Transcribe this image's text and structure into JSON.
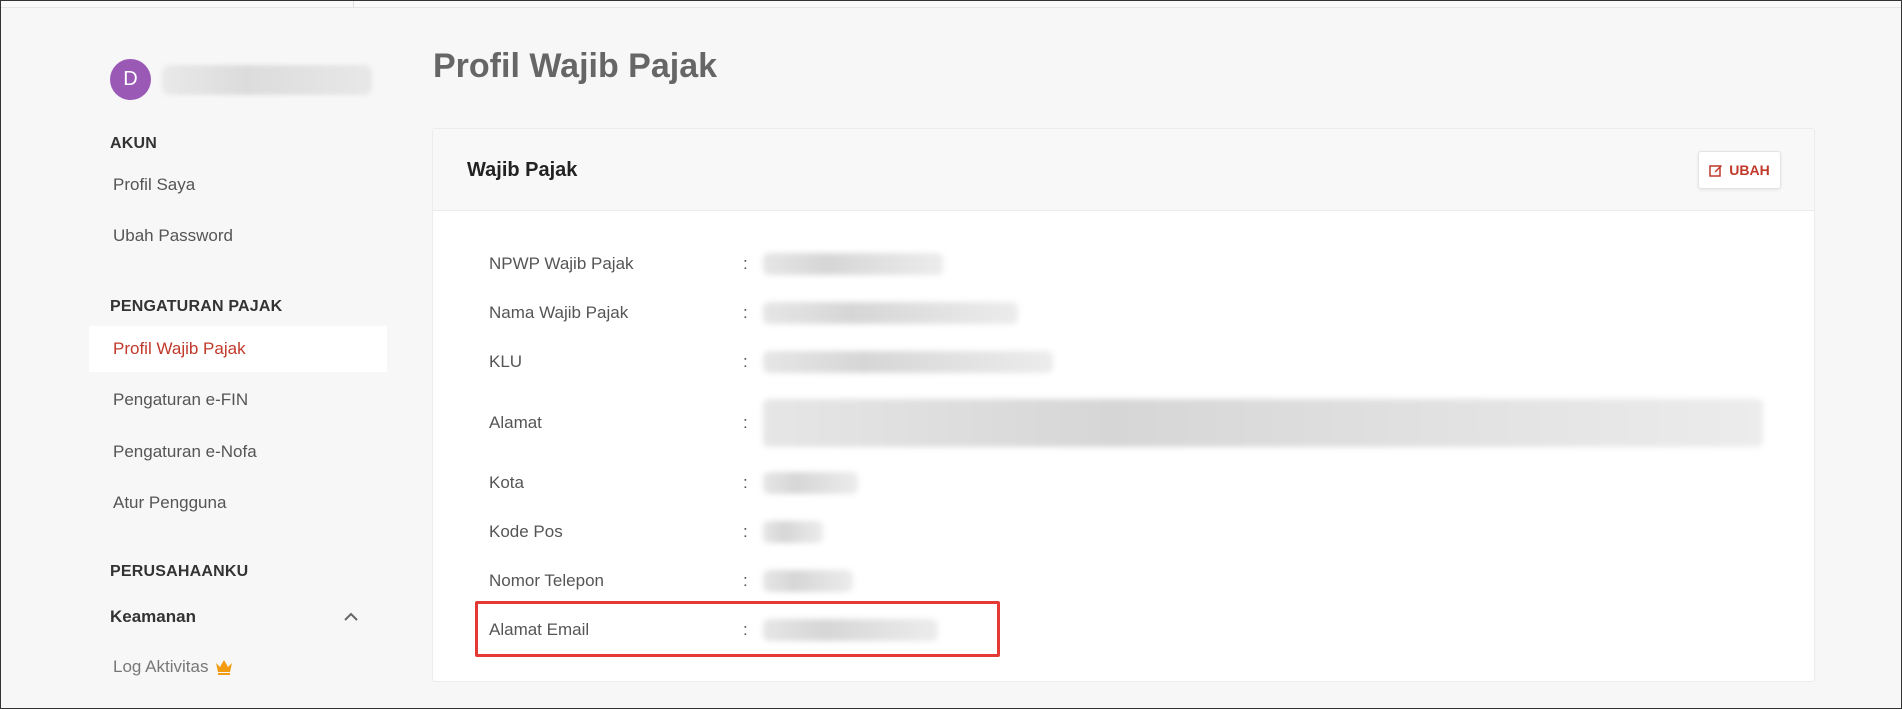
{
  "user": {
    "avatar_initial": "D"
  },
  "sidebar": {
    "sections": [
      {
        "title": "AKUN",
        "items": [
          "Profil Saya",
          "Ubah Password"
        ]
      },
      {
        "title": "PENGATURAN PAJAK",
        "items": [
          "Profil Wajib Pajak",
          "Pengaturan e-FIN",
          "Pengaturan e-Nofa",
          "Atur Pengguna"
        ]
      },
      {
        "title": "PERUSAHAANKU"
      }
    ],
    "active_item": "Profil Wajib Pajak",
    "group": {
      "label": "Keamanan",
      "expanded": true
    },
    "log_item": "Log Aktivitas"
  },
  "page": {
    "title": "Profil Wajib Pajak"
  },
  "card": {
    "title": "Wajib Pajak",
    "edit_button": "UBAH",
    "fields": [
      {
        "label": "NPWP Wajib Pajak"
      },
      {
        "label": "Nama Wajib Pajak"
      },
      {
        "label": "KLU"
      },
      {
        "label": "Alamat"
      },
      {
        "label": "Kota"
      },
      {
        "label": "Kode Pos"
      },
      {
        "label": "Nomor Telepon"
      },
      {
        "label": "Alamat Email"
      }
    ],
    "separator": ":"
  },
  "colors": {
    "accent": "#c0392b",
    "avatar": "#9b59b6",
    "highlight_border": "#e53935",
    "crown": "#f39c12"
  },
  "icons": [
    "edit-icon",
    "chevron-up-icon",
    "crown-icon"
  ]
}
